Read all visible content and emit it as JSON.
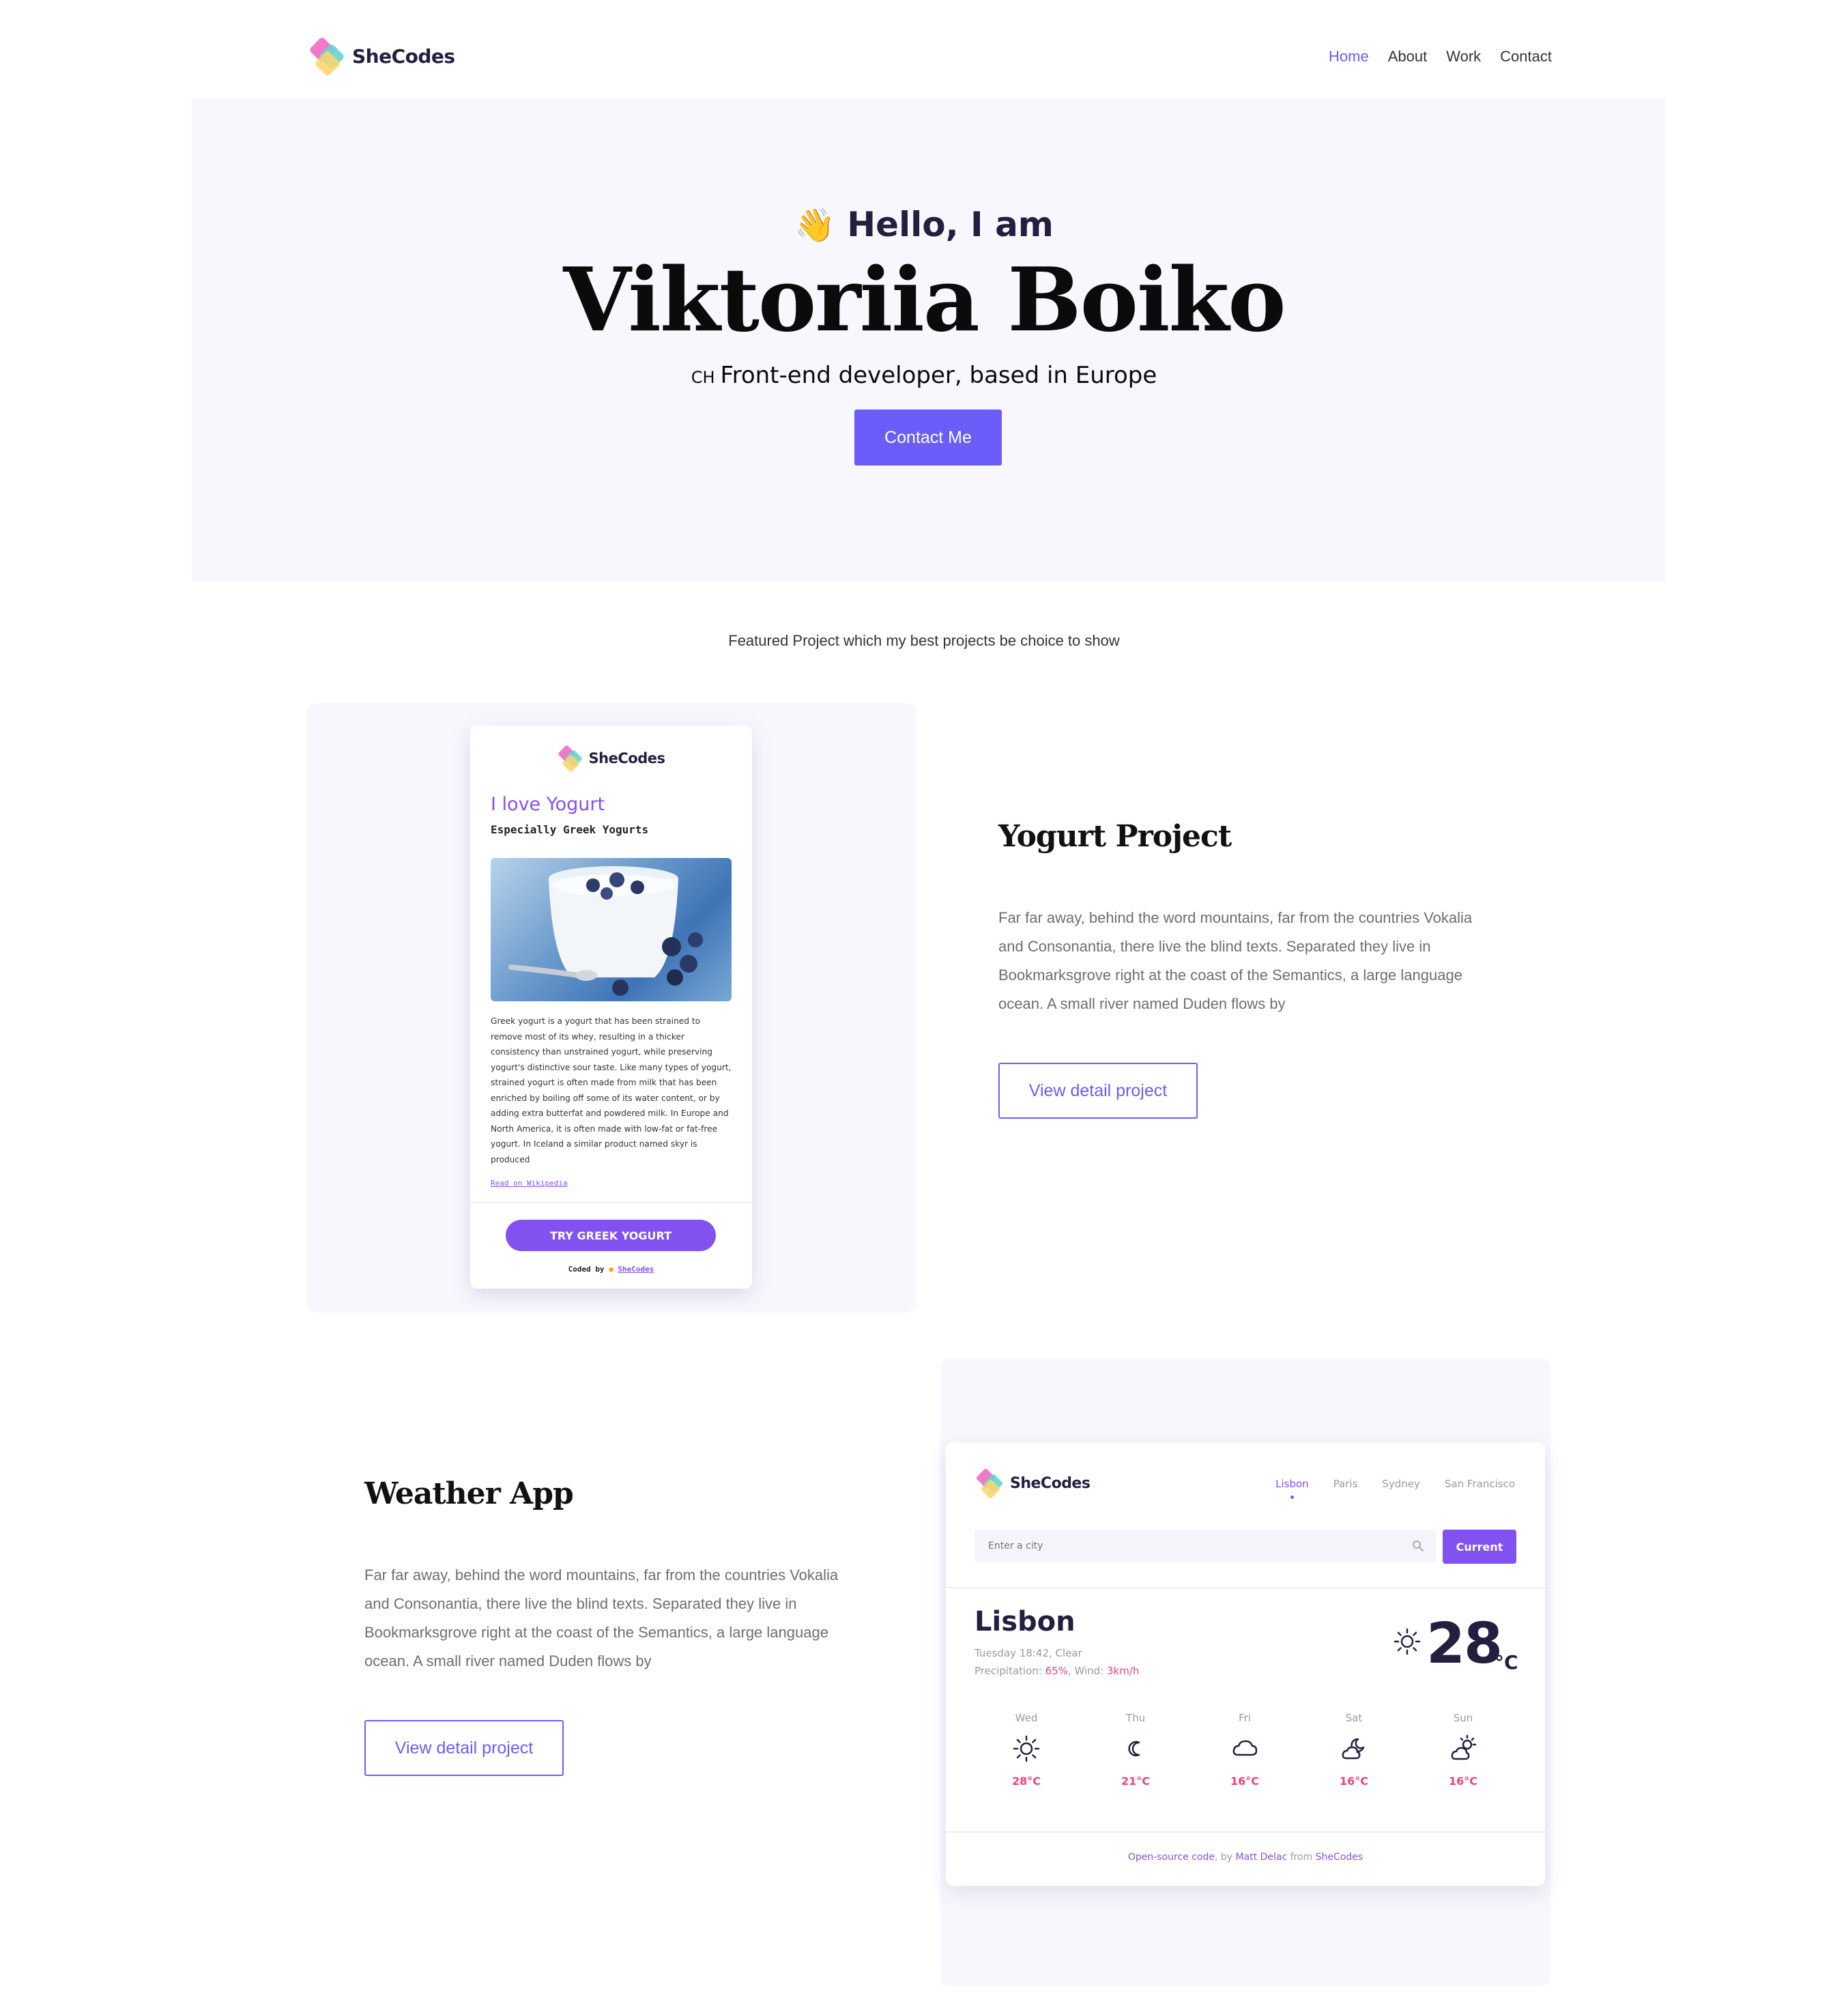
{
  "nav": {
    "logo_text": "SheCodes",
    "links": [
      "Home",
      "About",
      "Work",
      "Contact"
    ]
  },
  "hero": {
    "emoji": "👋",
    "greeting": "Hello, I am",
    "name": "Viktoriia Boiko",
    "tagline_prefix": "CH",
    "tagline": "Front-end developer, based in Europe",
    "cta": "Contact Me"
  },
  "featured_text": "Featured Project which my best projects be choice to show",
  "projects": [
    {
      "title": "Yogurt Project",
      "description": "Far far away, behind the word mountains, far from the countries Vokalia and Consonantia, there live the blind texts. Separated they live in Bookmarksgrove right at the coast of the Semantics, a large language ocean. A small river named Duden flows by",
      "button": "View detail project"
    },
    {
      "title": "Weather App",
      "description": "Far far away, behind the word mountains, far from the countries Vokalia and Consonantia, there live the blind texts. Separated they live in Bookmarksgrove right at the coast of the Semantics, a large language ocean. A small river named Duden flows by",
      "button": "View detail project"
    }
  ],
  "yogurt_preview": {
    "logo_text": "SheCodes",
    "heading": "I love Yogurt",
    "subheading": "Especially Greek Yogurts",
    "body": "Greek yogurt is a yogurt that has been strained to remove most of its whey, resulting in a thicker consistency than unstrained yogurt, while preserving yogurt's distinctive sour taste. Like many types of yogurt, strained yogurt is often made from milk that has been enriched by boiling off some of its water content, or by adding extra butterfat and powdered milk. In Europe and North America, it is often made with low-fat or fat-free yogurt. In Iceland a similar product named skyr is produced",
    "link": "Read on Wikipedia",
    "button": "TRY GREEK YOGURT",
    "coded_by": "Coded by",
    "coded_link": "SheCodes"
  },
  "weather_preview": {
    "logo_text": "SheCodes",
    "cities": [
      "Lisbon",
      "Paris",
      "Sydney",
      "San Francisco"
    ],
    "search_placeholder": "Enter a city",
    "current_button": "Current",
    "city": "Lisbon",
    "date": "Tuesday 18:42, Clear",
    "precip_label": "Precipitation: ",
    "precip_value": "65%",
    "wind_label": ", Wind: ",
    "wind_value": "3km/h",
    "temperature": "28",
    "unit": "°C",
    "forecast": [
      {
        "day": "Wed",
        "icon": "sun-icon",
        "temp": "28°C"
      },
      {
        "day": "Thu",
        "icon": "moon-icon",
        "temp": "21°C"
      },
      {
        "day": "Fri",
        "icon": "cloud-icon",
        "temp": "16°C"
      },
      {
        "day": "Sat",
        "icon": "cloudy-moon-icon",
        "temp": "16°C"
      },
      {
        "day": "Sun",
        "icon": "partly-cloudy-icon",
        "temp": "16°C"
      }
    ],
    "footer": {
      "link1": "Open-source code",
      "text1": ", by ",
      "link2": "Matt Delac",
      "text2": " from ",
      "link3": "SheCodes"
    }
  },
  "colors": {
    "accent": "#6a5dfa",
    "purple": "#8252f0",
    "pink": "#f0417f",
    "hero_bg": "#f8f7fd"
  }
}
